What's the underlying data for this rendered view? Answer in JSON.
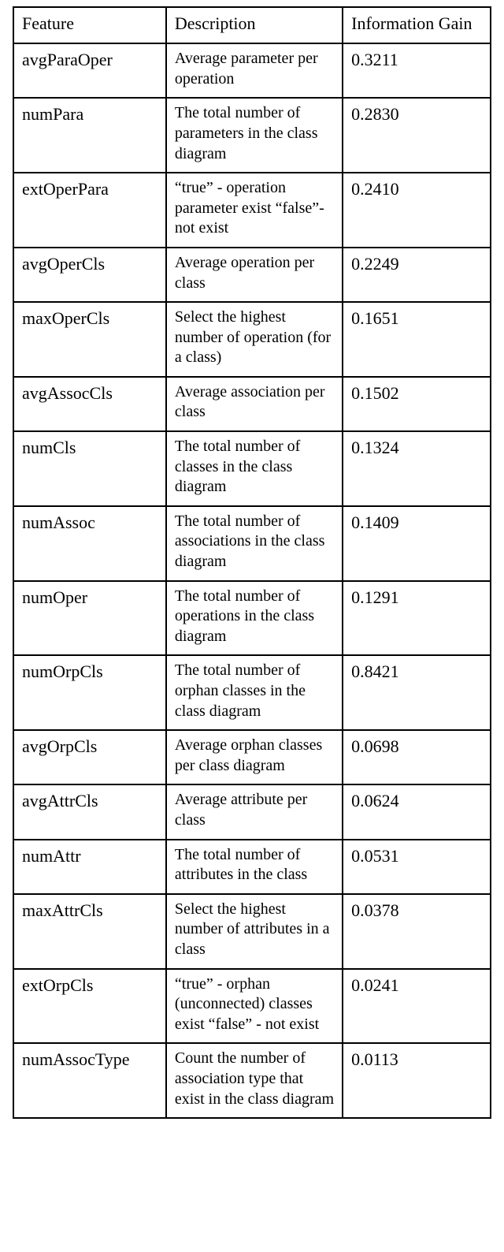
{
  "caption": "",
  "headers": {
    "feature": "Feature",
    "description": "Description",
    "gain": "Information Gain"
  },
  "rows": [
    {
      "feature": "avgParaOper",
      "description": "Average parameter per operation",
      "gain": "0.3211"
    },
    {
      "feature": "numPara",
      "description": "The total number of parameters in the class diagram",
      "gain": "0.2830"
    },
    {
      "feature": "extOperPara",
      "description": "“true” - operation parameter exist “false”- not exist",
      "gain": "0.2410"
    },
    {
      "feature": "avgOperCls",
      "description": "Average operation per class",
      "gain": "0.2249"
    },
    {
      "feature": "maxOperCls",
      "description": "Select the highest number of operation (for a class)",
      "gain": "0.1651"
    },
    {
      "feature": "avgAssocCls",
      "description": "Average association per class",
      "gain": "0.1502"
    },
    {
      "feature": "numCls",
      "description": "The total number of classes in the class diagram",
      "gain": "0.1324"
    },
    {
      "feature": "numAssoc",
      "description": "The total number of associations in the class diagram",
      "gain": "0.1409"
    },
    {
      "feature": "numOper",
      "description": "The total number of operations in the class diagram",
      "gain": "0.1291"
    },
    {
      "feature": "numOrpCls",
      "description": "The total number of orphan classes in the class diagram",
      "gain": "0.8421"
    },
    {
      "feature": "avgOrpCls",
      "description": "Average orphan classes per class diagram",
      "gain": "0.0698"
    },
    {
      "feature": "avgAttrCls",
      "description": "Average attribute per class",
      "gain": "0.0624"
    },
    {
      "feature": "numAttr",
      "description": "The total number of attributes in the class",
      "gain": "0.0531"
    },
    {
      "feature": "maxAttrCls",
      "description": "Select the highest number of attributes in a class",
      "gain": "0.0378"
    },
    {
      "feature": "extOrpCls",
      "description": "“true” - orphan (unconnected) classes exist “false” - not exist",
      "gain": "0.0241"
    },
    {
      "feature": "numAssocType",
      "description": "Count the number of association type that exist in the class diagram",
      "gain": "0.0113"
    }
  ],
  "chart_data": {
    "type": "table",
    "title": "Features & InfoGain Results",
    "columns": [
      "Feature",
      "Description",
      "Information Gain"
    ],
    "data": [
      [
        "avgParaOper",
        "Average parameter per operation",
        0.3211
      ],
      [
        "numPara",
        "The total number of parameters in the class diagram",
        0.283
      ],
      [
        "extOperPara",
        "\"true\" - operation parameter exist \"false\"- not exist",
        0.241
      ],
      [
        "avgOperCls",
        "Average operation per class",
        0.2249
      ],
      [
        "maxOperCls",
        "Select the highest number of operation (for a class)",
        0.1651
      ],
      [
        "avgAssocCls",
        "Average association per class",
        0.1502
      ],
      [
        "numCls",
        "The total number of classes in the class diagram",
        0.1324
      ],
      [
        "numAssoc",
        "The total number of associations in the class diagram",
        0.1409
      ],
      [
        "numOper",
        "The total number of operations in the class diagram",
        0.1291
      ],
      [
        "numOrpCls",
        "The total number of orphan classes in the class diagram",
        0.8421
      ],
      [
        "avgOrpCls",
        "Average orphan classes per class diagram",
        0.0698
      ],
      [
        "avgAttrCls",
        "Average attribute per class",
        0.0624
      ],
      [
        "numAttr",
        "The total number of attributes in the class",
        0.0531
      ],
      [
        "maxAttrCls",
        "Select the highest number of attributes in a class",
        0.0378
      ],
      [
        "extOrpCls",
        "\"true\" - orphan (unconnected) classes exist \"false\" - not exist",
        0.0241
      ],
      [
        "numAssocType",
        "Count the number of association type that exist in the class diagram",
        0.0113
      ]
    ]
  }
}
